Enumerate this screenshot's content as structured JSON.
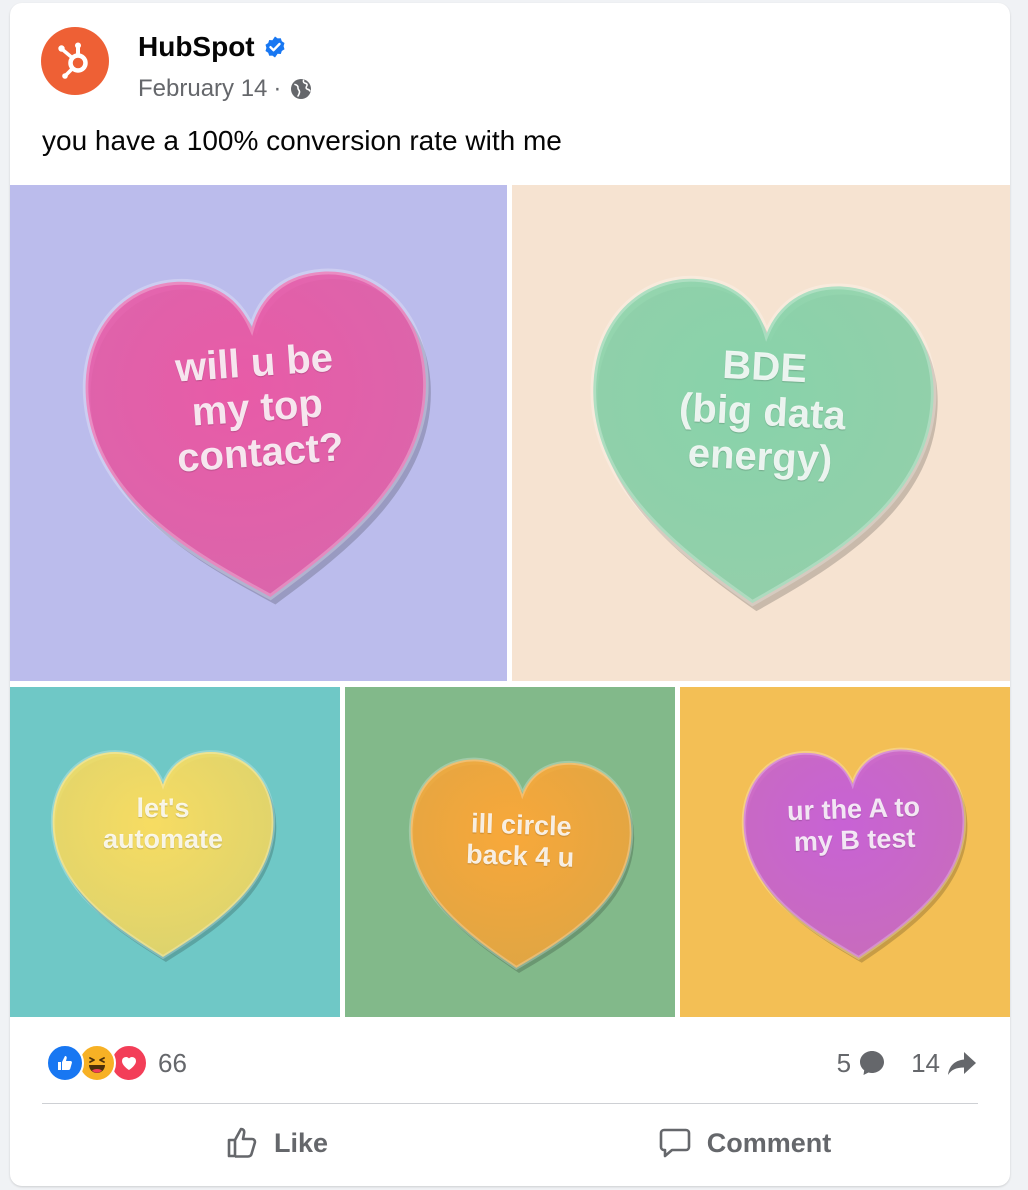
{
  "post": {
    "page_name": "HubSpot",
    "verified_icon": "verified-badge-icon",
    "date": "February 14",
    "separator": "·",
    "audience_icon": "globe-icon",
    "text": "you have a 100% conversion rate with me"
  },
  "colors": {
    "brand": "#ee6035",
    "verified": "#1877f2",
    "like": "#1877f2",
    "love": "#f33e58",
    "haha": "#f7b125",
    "tile_lavender": "#bbbcec",
    "tile_peach": "#f6e3d1",
    "tile_teal": "#6fc8c6",
    "tile_green": "#82b98a",
    "tile_amber": "#f3bf55",
    "heart_pink": "#e85ba7",
    "heart_green": "#88d3aa",
    "heart_yellow": "#f7dc62",
    "heart_orange": "#f8a83a",
    "heart_purple": "#c862d5"
  },
  "hearts": [
    {
      "text": "will u be\nmy top\ncontact?",
      "heart_color": "#e85ba7",
      "tile_color": "#bbbcec"
    },
    {
      "text": "BDE\n(big data\nenergy)",
      "heart_color": "#88d3aa",
      "tile_color": "#f6e3d1"
    },
    {
      "text": "let's\nautomate",
      "heart_color": "#f7dc62",
      "tile_color": "#6fc8c6"
    },
    {
      "text": "ill circle\nback 4 u",
      "heart_color": "#f8a83a",
      "tile_color": "#82b98a"
    },
    {
      "text": "ur the A to\nmy B test",
      "heart_color": "#c862d5",
      "tile_color": "#f3bf55"
    }
  ],
  "reactions": {
    "icons": [
      "like-icon",
      "haha-icon",
      "love-icon"
    ],
    "count": "66"
  },
  "stats": {
    "comments": "5",
    "comment_icon": "comment-bubble-icon",
    "shares": "14",
    "share_icon": "share-arrow-icon"
  },
  "actions": {
    "like_label": "Like",
    "like_icon": "thumbs-up-icon",
    "comment_label": "Comment",
    "comment_icon": "comment-icon"
  }
}
